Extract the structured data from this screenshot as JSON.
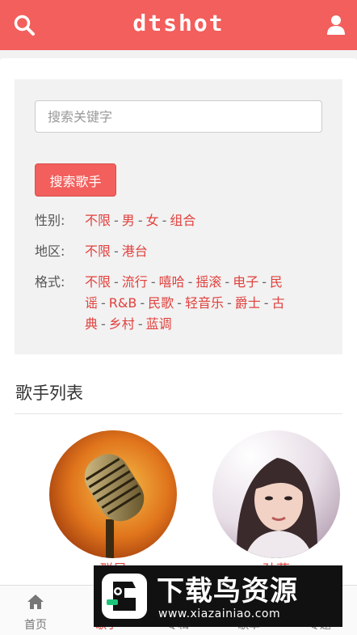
{
  "header": {
    "logo": "dtshot"
  },
  "search": {
    "placeholder": "搜索关键字",
    "value": "",
    "button": "搜索歌手"
  },
  "filters": {
    "gender": {
      "label": "性别:",
      "options": [
        "不限",
        "男",
        "女",
        "组合"
      ]
    },
    "region": {
      "label": "地区:",
      "options": [
        "不限",
        "港台"
      ]
    },
    "genre": {
      "label": "格式:",
      "options": [
        "不限",
        "流行",
        "嘻哈",
        "摇滚",
        "电子",
        "民谣",
        "R&B",
        "民歌",
        "轻音乐",
        "爵士",
        "古典",
        "乡村",
        "蓝调"
      ]
    }
  },
  "section": {
    "title": "歌手列表"
  },
  "singers": [
    {
      "name": "群星",
      "photo_icon": "microphone-photo"
    },
    {
      "name": "孙燕",
      "photo_icon": "portrait-photo"
    }
  ],
  "tabs": [
    {
      "label": "首页",
      "icon": "home-icon",
      "active": false
    },
    {
      "label": "歌手",
      "icon": "singer-icon",
      "active": true
    },
    {
      "label": "专辑",
      "icon": "album-icon",
      "active": false
    },
    {
      "label": "歌单",
      "icon": "playlist-icon",
      "active": false
    },
    {
      "label": "专题",
      "icon": "topic-icon",
      "active": false
    }
  ],
  "watermark": {
    "title": "下载鸟资源",
    "url": "www.xiazainiao.com"
  },
  "colors": {
    "accent": "#f25f5c",
    "link": "#e0413d"
  }
}
